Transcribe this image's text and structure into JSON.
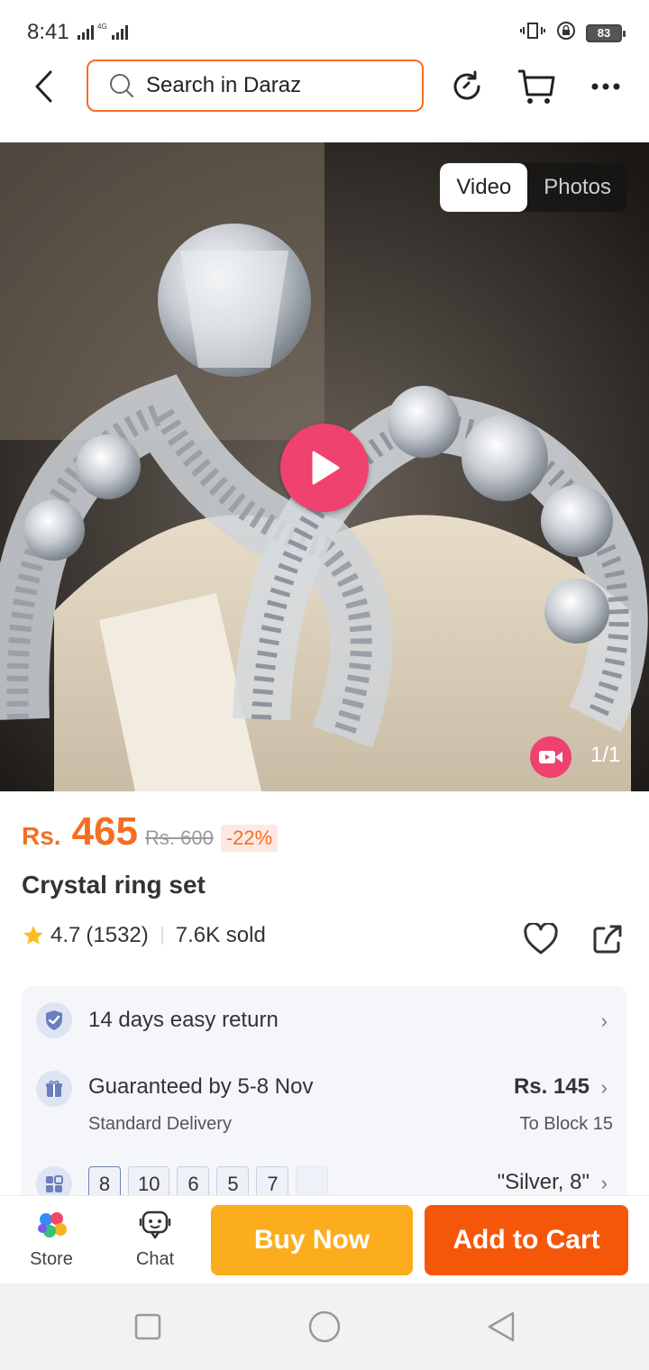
{
  "status_bar": {
    "time": "8:41",
    "network": "4G",
    "battery": "83"
  },
  "search": {
    "placeholder": "Search in Daraz"
  },
  "media": {
    "tabs": [
      "Video",
      "Photos"
    ],
    "active_tab": "Video",
    "counter": "1/1"
  },
  "product": {
    "currency": "Rs.",
    "price": "465",
    "old_price": "Rs. 600",
    "discount": "-22%",
    "title": "Crystal ring set",
    "rating": "4.7",
    "reviews": "(1532)",
    "sold": "7.6K sold"
  },
  "info": {
    "return_label": "14 days easy return",
    "delivery_label": "Guaranteed by 5-8 Nov",
    "delivery_type": "Standard Delivery",
    "delivery_price": "Rs. 145",
    "delivery_to": "To Block 15",
    "sizes": [
      "8",
      "10",
      "6",
      "5",
      "7"
    ],
    "selected_variant": "\"Silver, 8\""
  },
  "actions": {
    "store_label": "Store",
    "chat_label": "Chat",
    "buy_now": "Buy Now",
    "add_to_cart": "Add to Cart"
  },
  "colors": {
    "brand_orange": "#f36f21",
    "buy_now": "#fcad1e",
    "add_to_cart": "#f5570a",
    "play": "#f0426e"
  }
}
